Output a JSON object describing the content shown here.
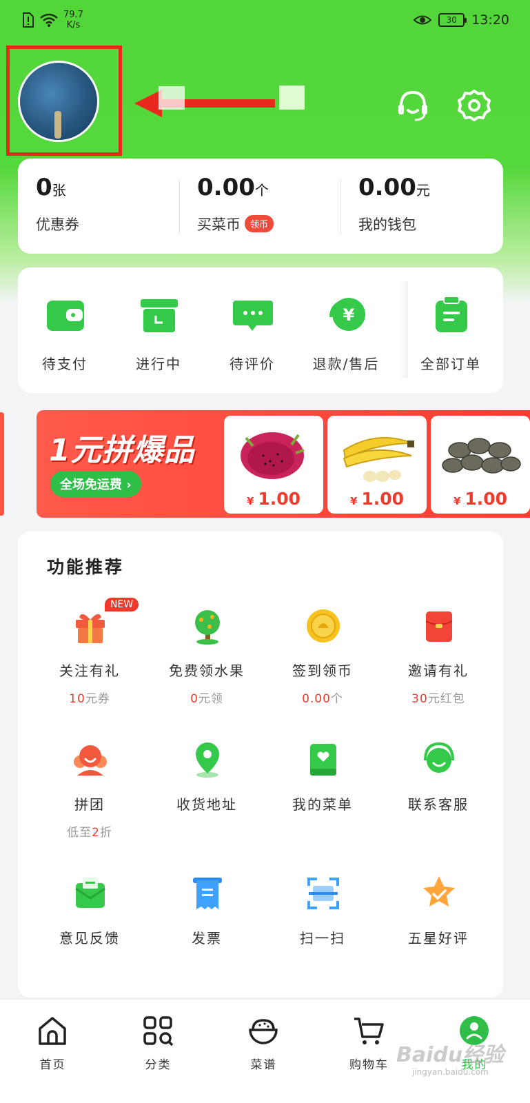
{
  "status": {
    "net_speed": "79.7",
    "net_unit": "K/s",
    "battery": "30",
    "time": "13:20"
  },
  "stats": [
    {
      "value": "0",
      "unit": "张",
      "label": "优惠券"
    },
    {
      "value": "0.00",
      "unit": "个",
      "label": "买菜币",
      "badge": "领币"
    },
    {
      "value": "0.00",
      "unit": "元",
      "label": "我的钱包"
    }
  ],
  "orders": [
    {
      "label": "待支付",
      "icon": "wallet-icon"
    },
    {
      "label": "进行中",
      "icon": "box-icon"
    },
    {
      "label": "待评价",
      "icon": "comment-icon"
    },
    {
      "label": "退款/售后",
      "icon": "refund-icon"
    },
    {
      "label": "全部订单",
      "icon": "clipboard-icon"
    }
  ],
  "banner": {
    "title": "1元拼爆品",
    "pill": "全场免运费 ›",
    "products": [
      {
        "name": "dragon-fruit",
        "currency": "¥",
        "price": "1.00"
      },
      {
        "name": "banana",
        "currency": "¥",
        "price": "1.00"
      },
      {
        "name": "nuts",
        "currency": "¥",
        "price": "1.00"
      }
    ]
  },
  "features": {
    "heading": "功能推荐",
    "new_badge": "NEW",
    "items": [
      {
        "label": "关注有礼",
        "sub_num": "10",
        "sub_text": "元券",
        "icon": "gift-icon"
      },
      {
        "label": "免费领水果",
        "sub_num": "0",
        "sub_text": "元领",
        "icon": "tree-icon"
      },
      {
        "label": "签到领币",
        "sub_num": "0.00",
        "sub_text": "个",
        "icon": "coin-icon"
      },
      {
        "label": "邀请有礼",
        "sub_num": "30",
        "sub_text": "元红包",
        "icon": "red-packet-icon"
      },
      {
        "label": "拼团",
        "sub_pre": "低至",
        "sub_num": "2",
        "sub_text": "折",
        "icon": "group-icon"
      },
      {
        "label": "收货地址",
        "icon": "location-icon"
      },
      {
        "label": "我的菜单",
        "icon": "menu-book-icon"
      },
      {
        "label": "联系客服",
        "icon": "headset-icon"
      },
      {
        "label": "意见反馈",
        "icon": "feedback-icon"
      },
      {
        "label": "发票",
        "icon": "invoice-icon"
      },
      {
        "label": "扫一扫",
        "icon": "scan-icon"
      },
      {
        "label": "五星好评",
        "icon": "star-icon"
      }
    ]
  },
  "tabs": [
    {
      "label": "首页",
      "icon": "home-icon"
    },
    {
      "label": "分类",
      "icon": "category-icon"
    },
    {
      "label": "菜谱",
      "icon": "recipe-icon"
    },
    {
      "label": "购物车",
      "icon": "cart-icon"
    },
    {
      "label": "我的",
      "icon": "profile-icon"
    }
  ],
  "watermark": {
    "text": "Baidu经验",
    "sub": "jingyan.baidu.com"
  },
  "colors": {
    "brand_green": "#52d63a",
    "accent_red": "#ef3b2e",
    "tab_active": "#2fbf49"
  }
}
